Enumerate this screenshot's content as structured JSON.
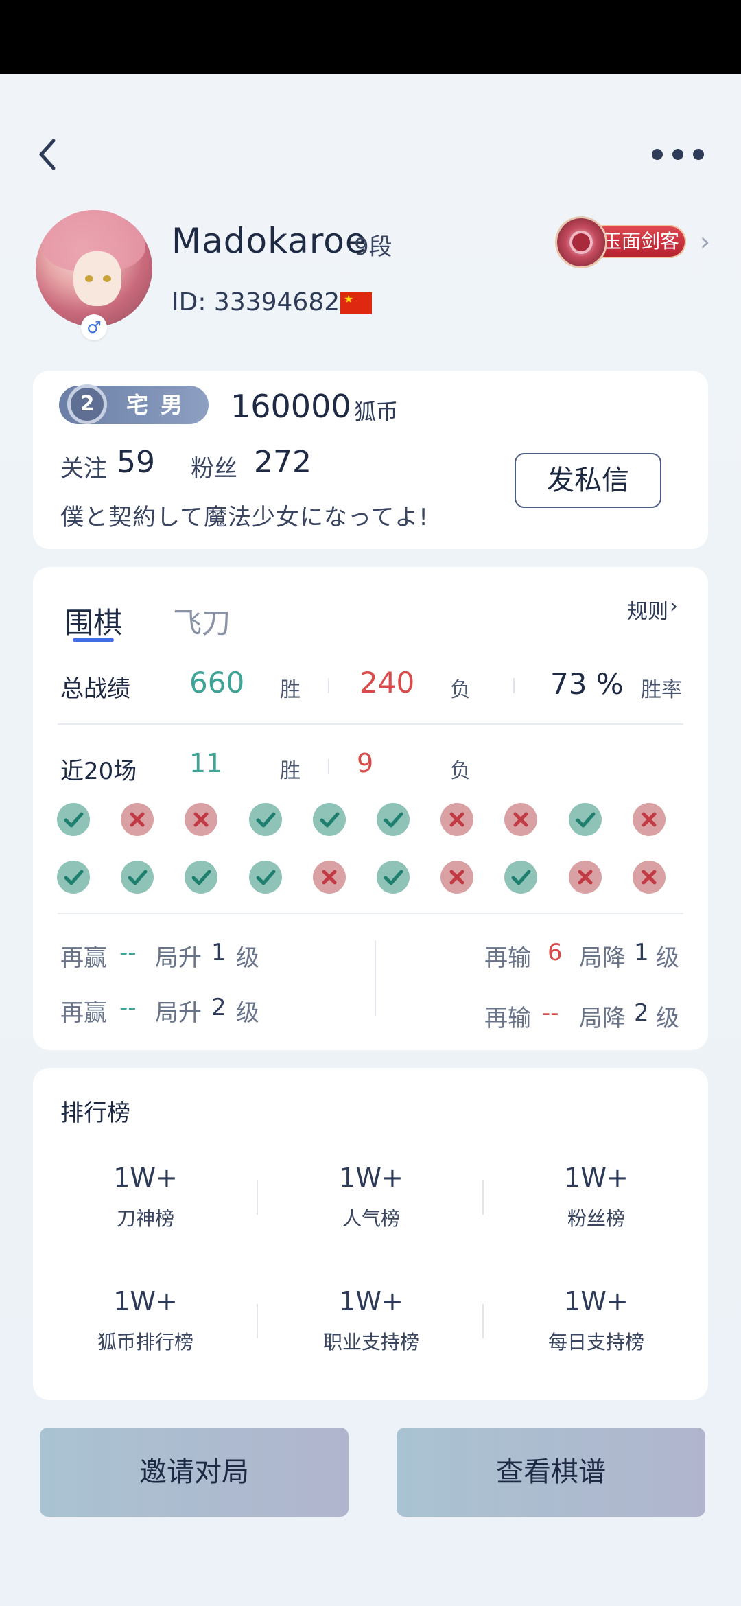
{
  "profile": {
    "username": "Madokaroe",
    "rank": "9段",
    "id_text": "ID: 33394682",
    "gender_symbol": "♂",
    "title_badge": "玉面剑客"
  },
  "summary": {
    "level_number": "2",
    "level_name": "宅男",
    "coins": "160000",
    "coins_unit": "狐币",
    "follow_label": "关注",
    "follow_count": "59",
    "fans_label": "粉丝",
    "fans_count": "272",
    "message_button": "发私信",
    "signature": "僕と契約して魔法少女になってよ!"
  },
  "tabs": [
    {
      "label": "围棋",
      "active": true
    },
    {
      "label": "飞刀",
      "active": false
    }
  ],
  "rules_label": "规则",
  "total": {
    "label": "总战绩",
    "wins": "660",
    "win_unit": "胜",
    "losses": "240",
    "loss_unit": "负",
    "rate": "73 %",
    "rate_unit": "胜率"
  },
  "recent": {
    "label": "近20场",
    "wins": "11",
    "win_unit": "胜",
    "losses": "9",
    "loss_unit": "负",
    "results": [
      "W",
      "L",
      "L",
      "W",
      "W",
      "W",
      "L",
      "L",
      "W",
      "L",
      "W",
      "W",
      "W",
      "W",
      "L",
      "W",
      "L",
      "W",
      "L",
      "L"
    ]
  },
  "level_progress": {
    "promote1": {
      "prefix": "再赢",
      "value": "--",
      "text": "局升",
      "level": "1",
      "suffix": "级"
    },
    "promote2": {
      "prefix": "再赢",
      "value": "--",
      "text": "局升",
      "level": "2",
      "suffix": "级"
    },
    "demote1": {
      "prefix": "再输",
      "value": "6",
      "text": "局降",
      "level": "1",
      "suffix": "级"
    },
    "demote2": {
      "prefix": "再输",
      "value": "--",
      "text": "局降",
      "level": "2",
      "suffix": "级"
    }
  },
  "leaderboard": {
    "title": "排行榜",
    "items": [
      {
        "value": "1W+",
        "name": "刀神榜"
      },
      {
        "value": "1W+",
        "name": "人气榜"
      },
      {
        "value": "1W+",
        "name": "粉丝榜"
      },
      {
        "value": "1W+",
        "name": "狐币排行榜"
      },
      {
        "value": "1W+",
        "name": "职业支持榜"
      },
      {
        "value": "1W+",
        "name": "每日支持榜"
      }
    ]
  },
  "actions": {
    "invite": "邀请对局",
    "view_records": "查看棋谱"
  },
  "colors": {
    "win": "#3ea495",
    "loss": "#d94a4a",
    "accent": "#3e6ee6"
  }
}
